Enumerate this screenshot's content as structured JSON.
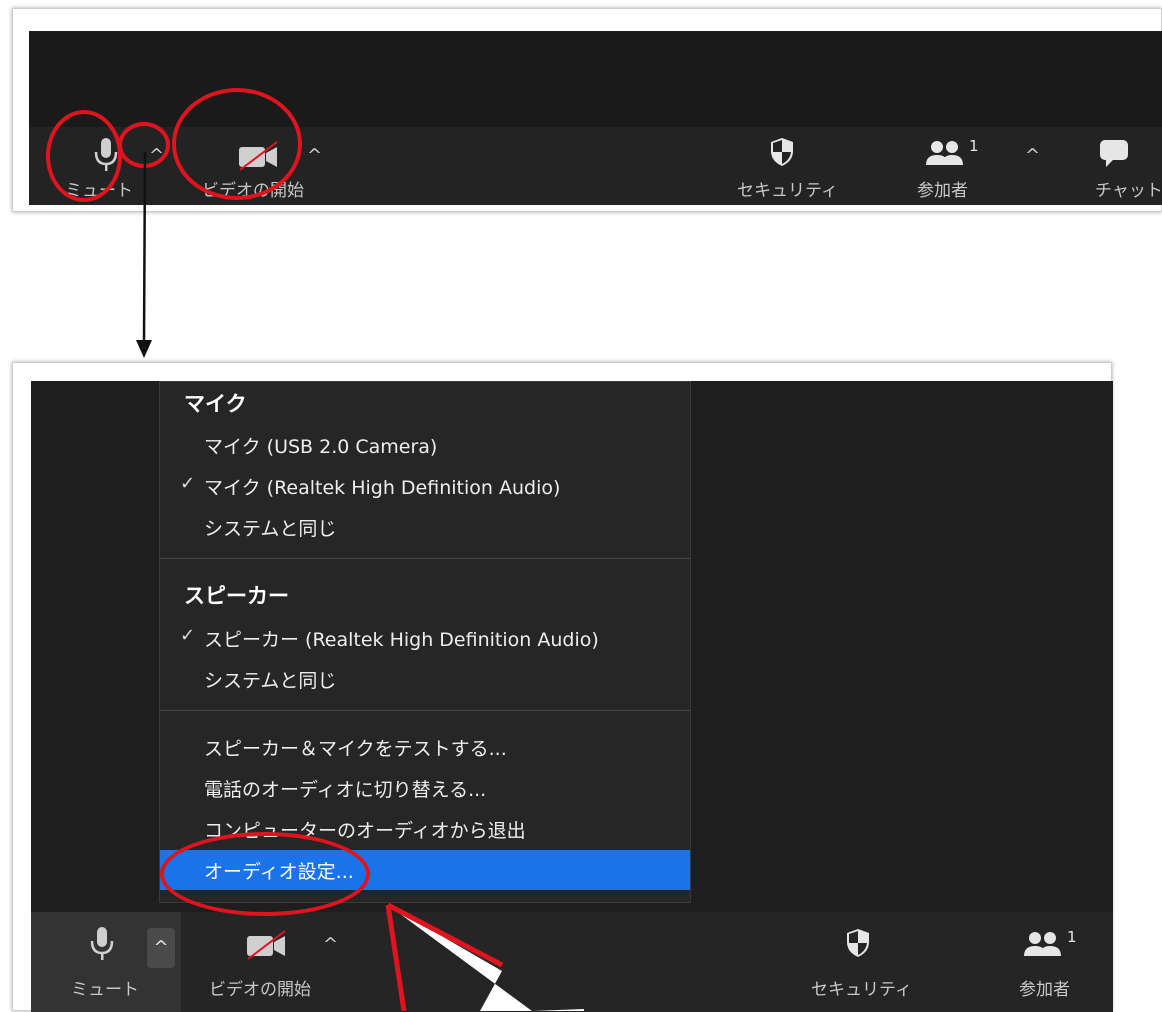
{
  "top_toolbar": {
    "mute_label": "ミュート",
    "video_label": "ビデオの開始",
    "security_label": "セキュリティ",
    "participants_label": "参加者",
    "participants_count": "1",
    "chat_label": "チャット"
  },
  "audio_menu": {
    "mic_heading": "マイク",
    "mic_items": [
      {
        "label": "マイク (USB 2.0 Camera)",
        "checked": false
      },
      {
        "label": "マイク (Realtek High Definition Audio)",
        "checked": true
      },
      {
        "label": "システムと同じ",
        "checked": false
      }
    ],
    "speaker_heading": "スピーカー",
    "speaker_items": [
      {
        "label": "スピーカー (Realtek High Definition Audio)",
        "checked": true
      },
      {
        "label": "システムと同じ",
        "checked": false
      }
    ],
    "actions": [
      "スピーカー＆マイクをテストする...",
      "電話のオーディオに切り替える...",
      "コンピューターのオーディオから退出",
      "オーディオ設定..."
    ],
    "check_glyph": "✓",
    "highlight_color": "#1a73e8"
  },
  "bottom_toolbar": {
    "mute_label": "ミュート",
    "video_label": "ビデオの開始",
    "security_label": "セキュリティ",
    "participants_label": "参加者",
    "participants_count": "1"
  },
  "annotation_color": "#e0141e"
}
